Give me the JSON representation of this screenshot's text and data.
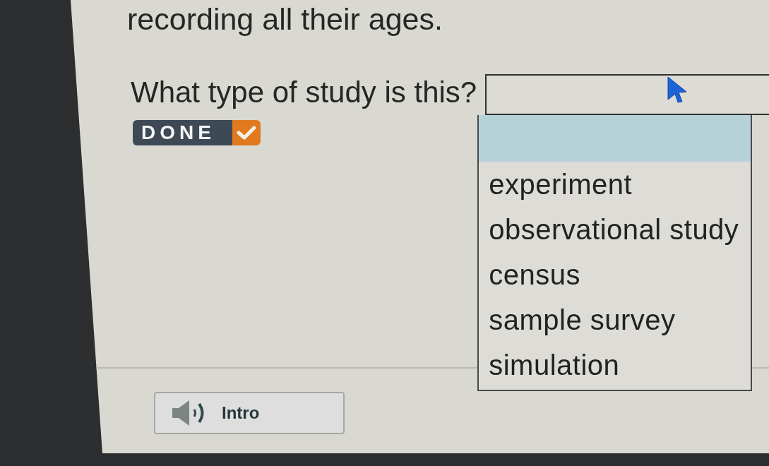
{
  "intro_text": "recording all their ages.",
  "question": {
    "text": "What type of study is this?",
    "status": {
      "label": "DONE",
      "done": true
    }
  },
  "dropdown": {
    "expanded": true,
    "blank_option_highlighted": true,
    "options": [
      {
        "label": "experiment",
        "selected": false
      },
      {
        "label": "observational study",
        "selected": false
      },
      {
        "label": "census",
        "selected": false
      },
      {
        "label": "sample survey",
        "selected": false
      },
      {
        "label": "simulation",
        "selected": false
      }
    ]
  },
  "audio_button": {
    "label": "Intro"
  }
}
